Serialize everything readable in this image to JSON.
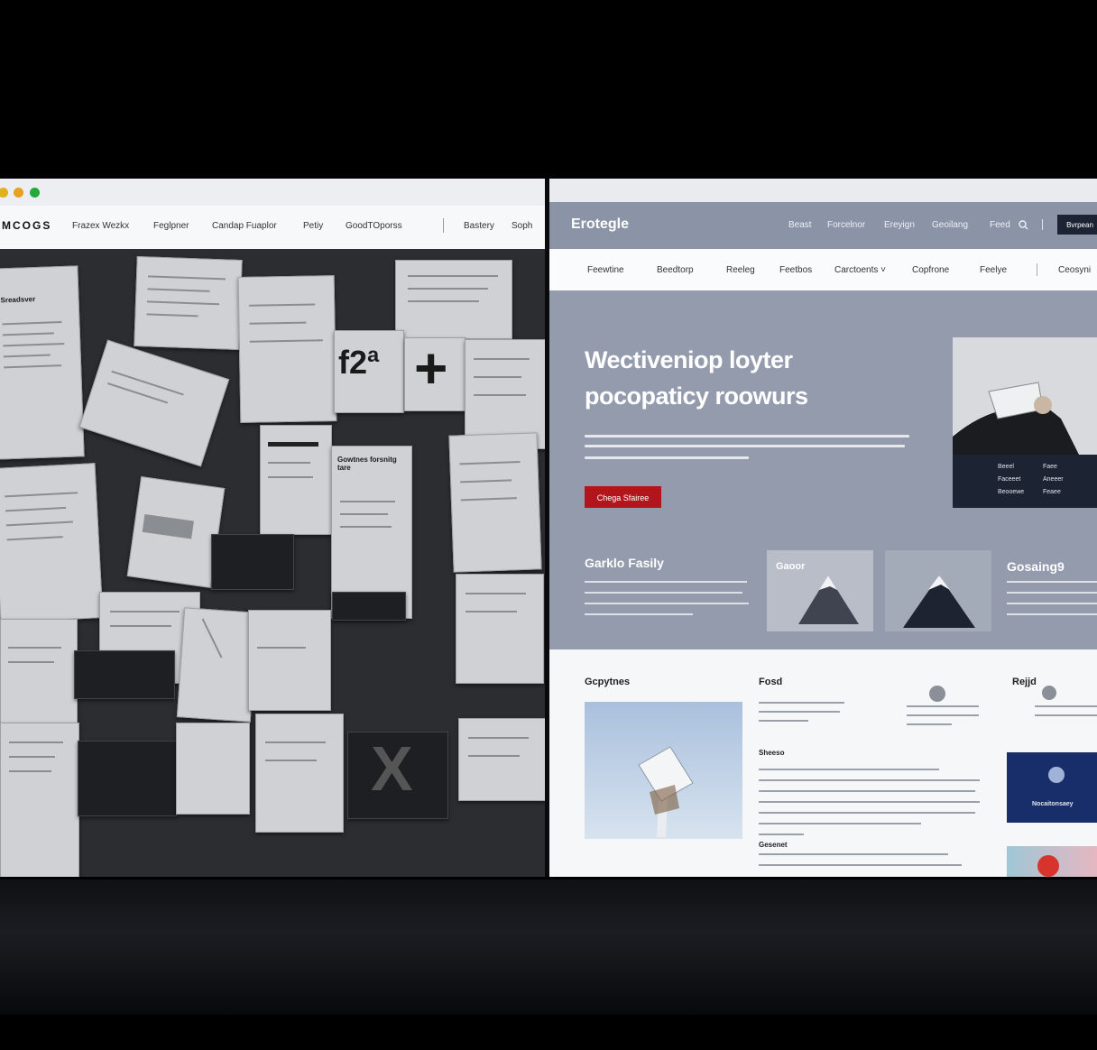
{
  "left_window": {
    "traffic_colors": [
      "#e0b020",
      "#e8a020",
      "#27a83a"
    ],
    "logo": "MCOGS",
    "nav": [
      "Frazex Wezkx",
      "Feglpner",
      "Candap Fuaplor",
      "Petiy",
      "GoodTOporss",
      "Bastery",
      "Soph"
    ],
    "collage_text": {
      "p1": "Sreadsver",
      "big_code": "f2ª",
      "plus": "+",
      "card1": "Gowtnes forsnitg tare",
      "x_mark": "X"
    }
  },
  "right_window": {
    "brand": "Erotegle",
    "top_nav": [
      "Beast",
      "Forcelnor",
      "Ereyign",
      "Geoilang",
      "Feed"
    ],
    "cta_label": "Bvrpean",
    "sub_nav": [
      "Feewtine",
      "Beedtorp",
      "Reeleg",
      "Feetbos",
      "Carctoents ˅",
      "Copfrone",
      "Feelye",
      "Ceosyni"
    ],
    "hero": {
      "title_line1": "Wectiveniop loyter",
      "title_line2": "pocopaticy roowurs",
      "cta": "Chega Sfairee",
      "card_rows": [
        [
          "Beeel",
          "Faee"
        ],
        [
          "Faceeet",
          "Aneeer"
        ],
        [
          "Beooewe",
          "Feaee"
        ]
      ]
    },
    "features": {
      "title1": "Garklo Fasily",
      "card_label": "Gaoor",
      "title2": "Gosaing9"
    },
    "section": {
      "h_left": "Gcpytnes",
      "h_mid": "Fosd",
      "h_right": "Rejjd",
      "sub1": "Sheeso",
      "sub2": "Gesenet",
      "card_dark_label": "Nocaitonsaey"
    }
  },
  "colors": {
    "hero_bg": "#949bad",
    "header_bg": "#8a94a6",
    "cta_red": "#b3151c"
  }
}
